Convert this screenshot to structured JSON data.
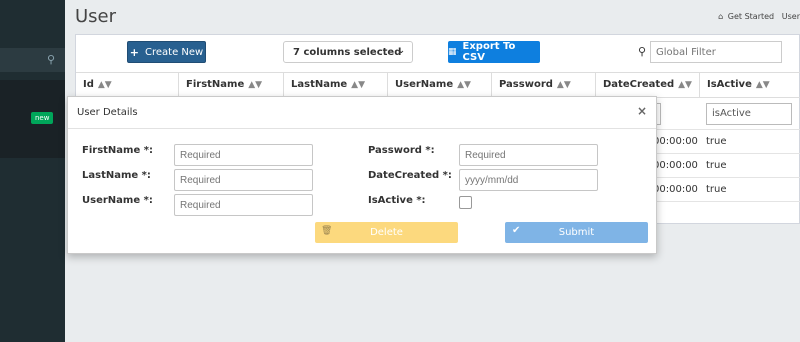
{
  "page": {
    "title": "User"
  },
  "breadcrumb": {
    "home": "Get Started",
    "current": "User"
  },
  "sidebar": {
    "badge": "new"
  },
  "toolbar": {
    "create_label": "Create New",
    "columns_label": "7 columns selected",
    "export_label": "Export To CSV",
    "filter_placeholder": "Global Filter"
  },
  "table": {
    "headers": [
      "Id",
      "FirstName",
      "LastName",
      "UserName",
      "Password",
      "DateCreated",
      "IsActive"
    ],
    "filter_isactive": "isActive",
    "rows": [
      {
        "date_fragment": "00:00:00",
        "isactive": "true"
      },
      {
        "date_fragment": "00:00:00",
        "isactive": "true"
      },
      {
        "date_fragment": "00:00:00",
        "isactive": "true"
      }
    ]
  },
  "modal": {
    "title": "User Details",
    "close": "×",
    "fields": {
      "firstname_label": "FirstName *:",
      "firstname_placeholder": "Required",
      "lastname_label": "LastName *:",
      "lastname_placeholder": "Required",
      "username_label": "UserName *:",
      "username_placeholder": "Required",
      "password_label": "Password *:",
      "password_placeholder": "Required",
      "datecreated_label": "DateCreated *:",
      "datecreated_placeholder": "yyyy/mm/dd",
      "isactive_label": "IsActive *:"
    },
    "delete_label": "Delete",
    "submit_label": "Submit"
  },
  "colors": {
    "primary": "#286090",
    "export": "#0e7fdf",
    "delete": "#fcd97e",
    "submit": "#7fb4e6",
    "sidebar": "#1f2d32"
  },
  "icons": [
    "search-icon",
    "home-icon",
    "plus-icon",
    "chevron-down-icon",
    "file-icon",
    "sort-icon",
    "close-icon",
    "trash-icon",
    "check-icon"
  ]
}
